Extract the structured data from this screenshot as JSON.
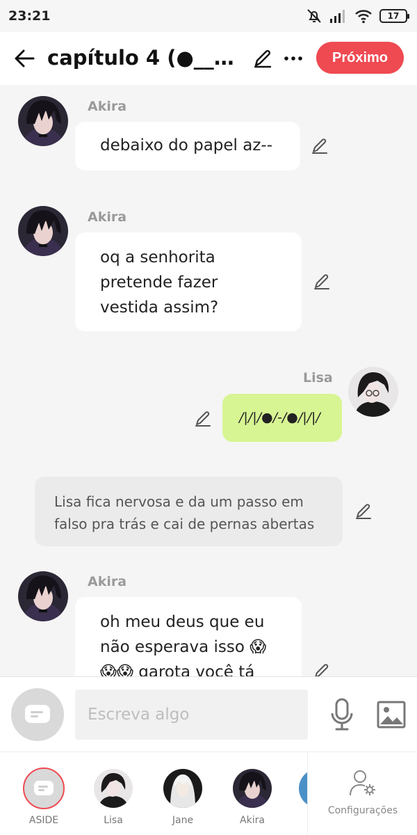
{
  "status": {
    "time": "23:21",
    "battery": "17"
  },
  "header": {
    "title": "capítulo 4  (●__●...",
    "next_label": "Próximo"
  },
  "messages": [
    {
      "name": "Akira",
      "text": "debaixo do papel az--"
    },
    {
      "name": "Akira",
      "lines": [
        "oq a senhorita",
        "pretende fazer",
        "vestida assim?"
      ]
    },
    {
      "name": "Lisa",
      "text": "/|/|/●/-/●/|/|/"
    },
    {
      "narration_lines": [
        "Lisa fica nervosa e da um passo em",
        "falso pra trás e cai de pernas abertas"
      ]
    },
    {
      "name": "Akira",
      "lines": [
        "oh meu deus que eu",
        "não esperava isso 😱",
        "😱😱 garota você tá"
      ]
    }
  ],
  "composer": {
    "placeholder": "Escreva algo"
  },
  "tabs": [
    {
      "label": "ASIDE"
    },
    {
      "label": "Lisa"
    },
    {
      "label": "Jane"
    },
    {
      "label": "Akira"
    }
  ],
  "settings_label": "Configurações",
  "colors": {
    "accent": "#ef4a52",
    "own_bubble": "#d8f593",
    "bubble": "#ffffff",
    "narration_bg": "#ebebeb"
  },
  "icons": [
    "back-arrow-icon",
    "pencil-icon",
    "more-dots-icon",
    "chat-bubble-icon",
    "microphone-icon",
    "image-icon",
    "person-gear-icon",
    "mute-bell-icon",
    "signal-icon",
    "wifi-icon",
    "battery-icon"
  ]
}
